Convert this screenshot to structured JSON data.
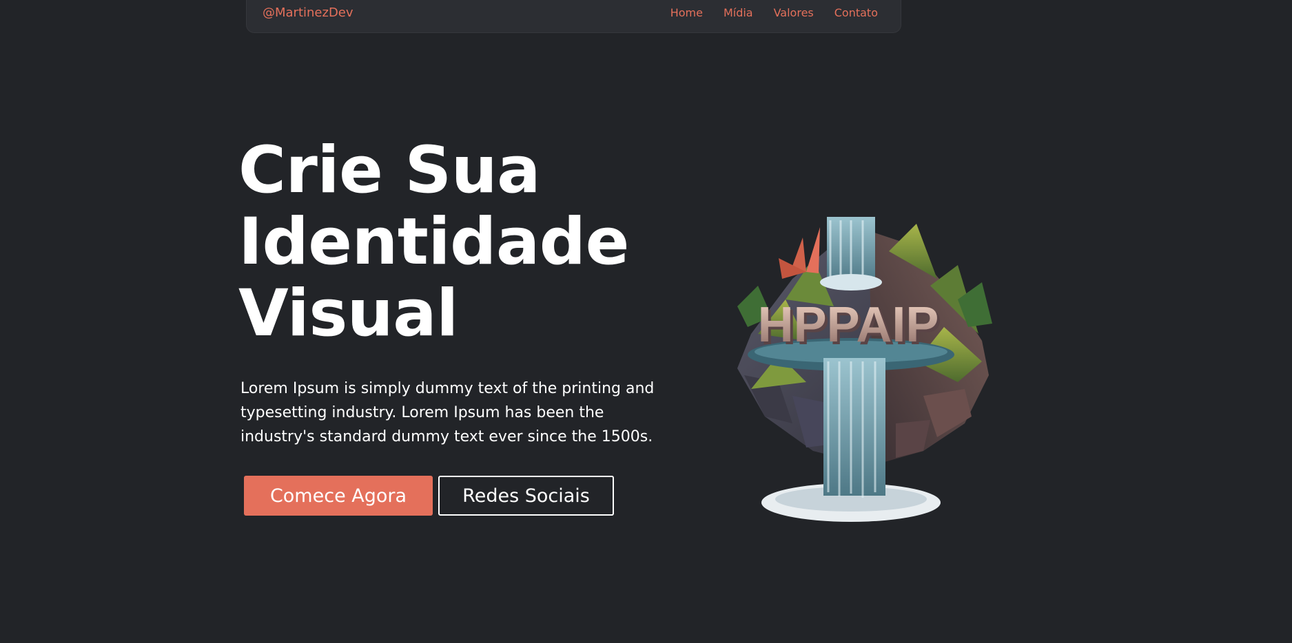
{
  "navbar": {
    "brand": "@MartinezDev",
    "links": [
      "Home",
      "Mídia",
      "Valores",
      "Contato"
    ]
  },
  "hero": {
    "title_lines": [
      "Crie Sua",
      "Identidade",
      "Visual"
    ],
    "description": "Lorem Ipsum is simply dummy text of the printing and typesetting industry. Lorem Ipsum has been the industry's standard dummy text ever since the 1500s.",
    "primary_button": "Comece Agora",
    "secondary_button": "Redes Sociais"
  },
  "illustration": {
    "sign_text": "HPPAIP",
    "icon": "waterfall-island-illustration"
  },
  "colors": {
    "background": "#222428",
    "navbar": "#2c2e33",
    "accent": "#e4705b",
    "text": "#ffffff"
  }
}
